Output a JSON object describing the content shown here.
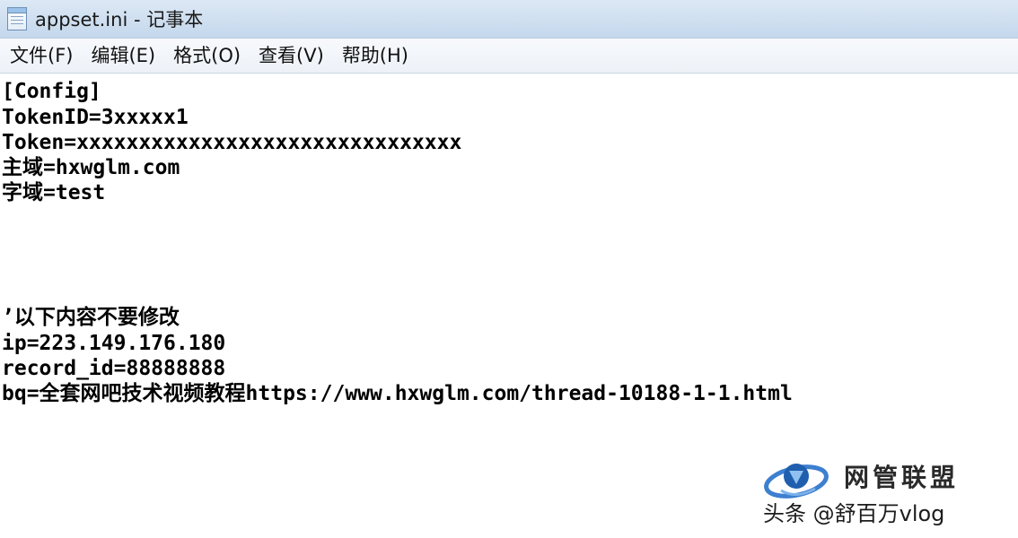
{
  "window": {
    "title": "appset.ini - 记事本"
  },
  "menu": {
    "items": [
      {
        "label": "文件(F)"
      },
      {
        "label": "编辑(E)"
      },
      {
        "label": "格式(O)"
      },
      {
        "label": "查看(V)"
      },
      {
        "label": "帮助(H)"
      }
    ]
  },
  "editor": {
    "lines": [
      "[Config]",
      "TokenID=3xxxxx1",
      "Token=xxxxxxxxxxxxxxxxxxxxxxxxxxxxxxx",
      "主域=hxwglm.com",
      "字域=test",
      "",
      "",
      "",
      "",
      "’以下内容不要修改",
      "ip=223.149.176.180",
      "record_id=88888888",
      "bq=全套网吧技术视频教程https://www.hxwglm.com/thread-10188-1-1.html"
    ]
  },
  "watermark": {
    "logo_text": "网管联盟",
    "source_text": "头条 @舒百万vlog"
  },
  "colors": {
    "titlebar": "#cfdff0",
    "menubar": "#edf2f8",
    "editor_bg": "#ffffff",
    "text": "#000000"
  },
  "icons": {
    "app": "notepad-icon",
    "logo": "logo-emblem-icon"
  }
}
